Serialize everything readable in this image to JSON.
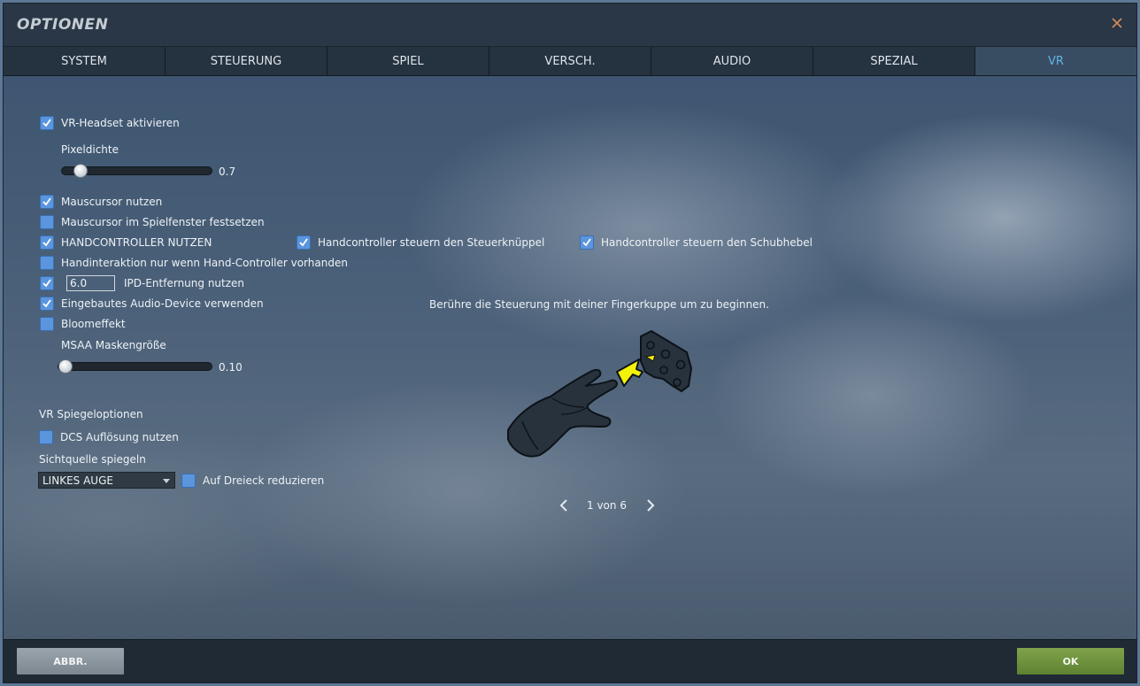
{
  "window": {
    "title": "OPTIONEN"
  },
  "tabs": [
    {
      "label": "SYSTEM"
    },
    {
      "label": "STEUERUNG"
    },
    {
      "label": "SPIEL"
    },
    {
      "label": "VERSCH."
    },
    {
      "label": "AUDIO"
    },
    {
      "label": "SPEZIAL"
    },
    {
      "label": "VR",
      "active": true
    }
  ],
  "vr": {
    "headset": {
      "label": "VR-Headset aktivieren",
      "checked": true
    },
    "pixel_density": {
      "label": "Pixeldichte",
      "value": "0.7",
      "level": 0.12
    },
    "mouse_cursor": {
      "label": "Mauscursor nutzen",
      "checked": true
    },
    "mouse_lock": {
      "label": "Mauscursor im Spielfenster festsetzen",
      "checked": false
    },
    "hand_controllers": {
      "label": "HANDCONTROLLER NUTZEN",
      "checked": true
    },
    "hc_stick": {
      "label": "Handcontroller steuern den Steuerknüppel",
      "checked": true
    },
    "hc_throttle": {
      "label": "Handcontroller steuern den Schubhebel",
      "checked": true
    },
    "hand_interaction": {
      "label": "Handinteraktion nur wenn Hand-Controller vorhanden",
      "checked": false
    },
    "ipd": {
      "label": "IPD-Entfernung nutzen",
      "value": "6.0",
      "checked": true
    },
    "audio_device": {
      "label": "Eingebautes Audio-Device verwenden",
      "checked": true
    },
    "bloom": {
      "label": "Bloomeffekt",
      "checked": false
    },
    "msaa": {
      "label": "MSAA Maskengröße",
      "value": "0.10",
      "level": 0.03
    },
    "mirror_heading": "VR Spiegeloptionen",
    "dcs_resolution": {
      "label": "DCS Auflösung nutzen",
      "checked": false
    },
    "view_source_label": "Sichtquelle spiegeln",
    "view_source_value": "LINKES AUGE",
    "triangle": {
      "label": "Auf Dreieck reduzieren",
      "checked": false
    }
  },
  "tutorial": {
    "instruction": "Berühre die Steuerung mit deiner Fingerkuppe um zu beginnen.",
    "pager": "1 von 6",
    "image_icon": "gloved-hand-touching-panel-icon"
  },
  "footer": {
    "cancel_label": "ABBR.",
    "ok_label": "OK"
  },
  "colors": {
    "active_tab_text": "#5fb4e6",
    "checkbox": "#5a95de",
    "ok_button": "#6f9440",
    "pointer_arrow": "#f2f20a"
  }
}
